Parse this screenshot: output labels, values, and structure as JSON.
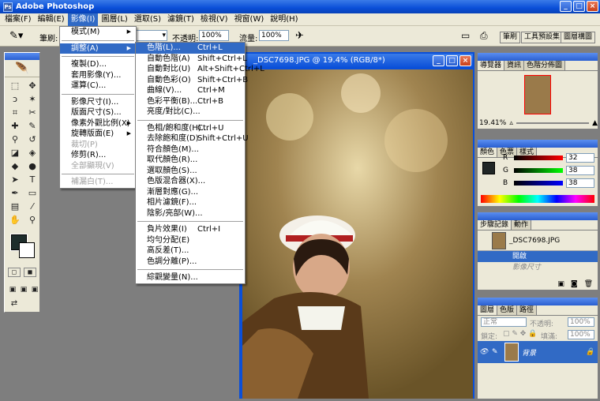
{
  "app": {
    "title": "Adobe Photoshop",
    "logo": "Ps"
  },
  "window_buttons": {
    "min": "_",
    "max": "□",
    "close": "×"
  },
  "menubar": [
    "檔案(F)",
    "編輯(E)",
    "影像(I)",
    "圖層(L)",
    "選取(S)",
    "濾鏡(T)",
    "檢視(V)",
    "視窗(W)",
    "說明(H)"
  ],
  "options": {
    "brush_label": "筆刷:",
    "opacity_label": "不透明:",
    "opacity_value": "100%",
    "flow_label": "流量:",
    "flow_value": "100%",
    "tabs": [
      "筆刷",
      "工具預設集",
      "圖層構圖"
    ]
  },
  "image_menu": [
    {
      "label": "模式(M)",
      "arrow": true
    },
    {
      "sep": true
    },
    {
      "label": "調整(A)",
      "arrow": true,
      "hl": true
    },
    {
      "sep": true
    },
    {
      "label": "複製(D)..."
    },
    {
      "label": "套用影像(Y)..."
    },
    {
      "label": "運算(C)..."
    },
    {
      "sep": true
    },
    {
      "label": "影像尺寸(I)..."
    },
    {
      "label": "版面尺寸(S)..."
    },
    {
      "label": "像素外觀比例(X)",
      "arrow": true
    },
    {
      "label": "旋轉版面(E)",
      "arrow": true
    },
    {
      "label": "裁切(P)",
      "dis": true
    },
    {
      "label": "修剪(R)..."
    },
    {
      "label": "全部顯現(V)",
      "dis": true
    },
    {
      "sep": true
    },
    {
      "label": "補漏白(T)...",
      "dis": true
    }
  ],
  "adjust_menu": [
    {
      "label": "色階(L)...",
      "sc": "Ctrl+L",
      "hl": true
    },
    {
      "label": "自動色階(A)",
      "sc": "Shift+Ctrl+L"
    },
    {
      "label": "自動對比(U)",
      "sc": "Alt+Shift+Ctrl+L"
    },
    {
      "label": "自動色彩(O)",
      "sc": "Shift+Ctrl+B"
    },
    {
      "label": "曲線(V)...",
      "sc": "Ctrl+M"
    },
    {
      "label": "色彩平衡(B)...",
      "sc": "Ctrl+B"
    },
    {
      "label": "亮度/對比(C)..."
    },
    {
      "sep": true
    },
    {
      "label": "色相/飽和度(H)...",
      "sc": "Ctrl+U"
    },
    {
      "label": "去除飽和度(D)",
      "sc": "Shift+Ctrl+U"
    },
    {
      "label": "符合顏色(M)..."
    },
    {
      "label": "取代顏色(R)..."
    },
    {
      "label": "選取顏色(S)..."
    },
    {
      "label": "色版混合器(X)..."
    },
    {
      "label": "漸層對應(G)..."
    },
    {
      "label": "相片濾鏡(F)..."
    },
    {
      "label": "陰影/亮部(W)..."
    },
    {
      "sep": true
    },
    {
      "label": "負片效果(I)",
      "sc": "Ctrl+I"
    },
    {
      "label": "均勻分配(E)"
    },
    {
      "label": "高反差(T)..."
    },
    {
      "label": "色調分離(P)..."
    },
    {
      "sep": true
    },
    {
      "label": "綜觀變量(N)..."
    }
  ],
  "document": {
    "title": "_DSC7698.JPG @ 19.4% (RGB/8*)"
  },
  "navigator": {
    "tabs": [
      "導覽器",
      "資訊",
      "色階分佈圖"
    ],
    "zoom": "19.41%"
  },
  "color_panel": {
    "tabs": [
      "顏色",
      "色票",
      "樣式"
    ],
    "r_label": "R",
    "g_label": "G",
    "b_label": "B",
    "r": "32",
    "g": "38",
    "b": "38",
    "fg": "#202626"
  },
  "history": {
    "tabs": [
      "步驟記錄",
      "動作"
    ],
    "snapshot": "_DSC7698.JPG",
    "items": [
      "開啟",
      "影像尺寸"
    ]
  },
  "layers": {
    "tabs": [
      "圖層",
      "色版",
      "路徑"
    ],
    "mode": "正常",
    "opacity_label": "不透明:",
    "opacity": "100%",
    "lock_label": "鎖定:",
    "fill_label": "填滿:",
    "fill": "100%",
    "layer_name": "背景"
  },
  "colors": {
    "accent": "#316ac5",
    "title": "#0a4fd8",
    "bg": "#ece9d8"
  }
}
